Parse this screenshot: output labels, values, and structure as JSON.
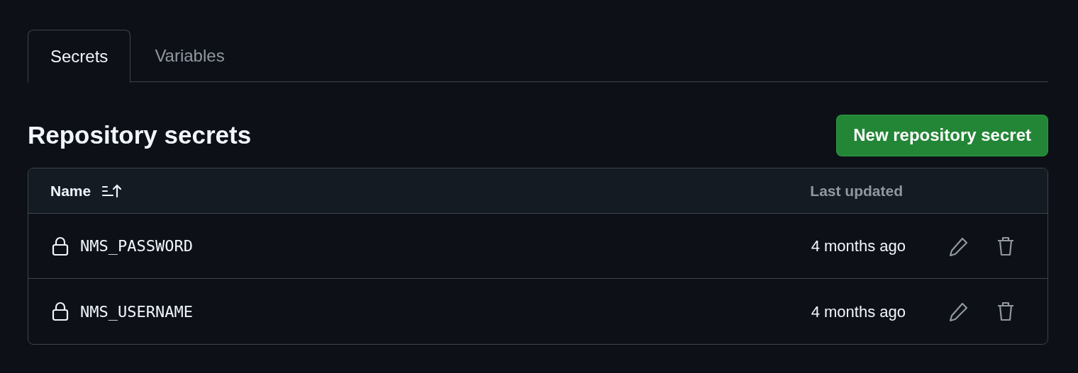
{
  "tabs": [
    {
      "label": "Secrets",
      "selected": true
    },
    {
      "label": "Variables",
      "selected": false
    }
  ],
  "section": {
    "title": "Repository secrets",
    "button": "New repository secret"
  },
  "table": {
    "columns": [
      "Name",
      "Last updated"
    ],
    "rows": [
      {
        "name": "NMS_PASSWORD",
        "updated": "4 months ago"
      },
      {
        "name": "NMS_USERNAME",
        "updated": "4 months ago"
      }
    ]
  }
}
